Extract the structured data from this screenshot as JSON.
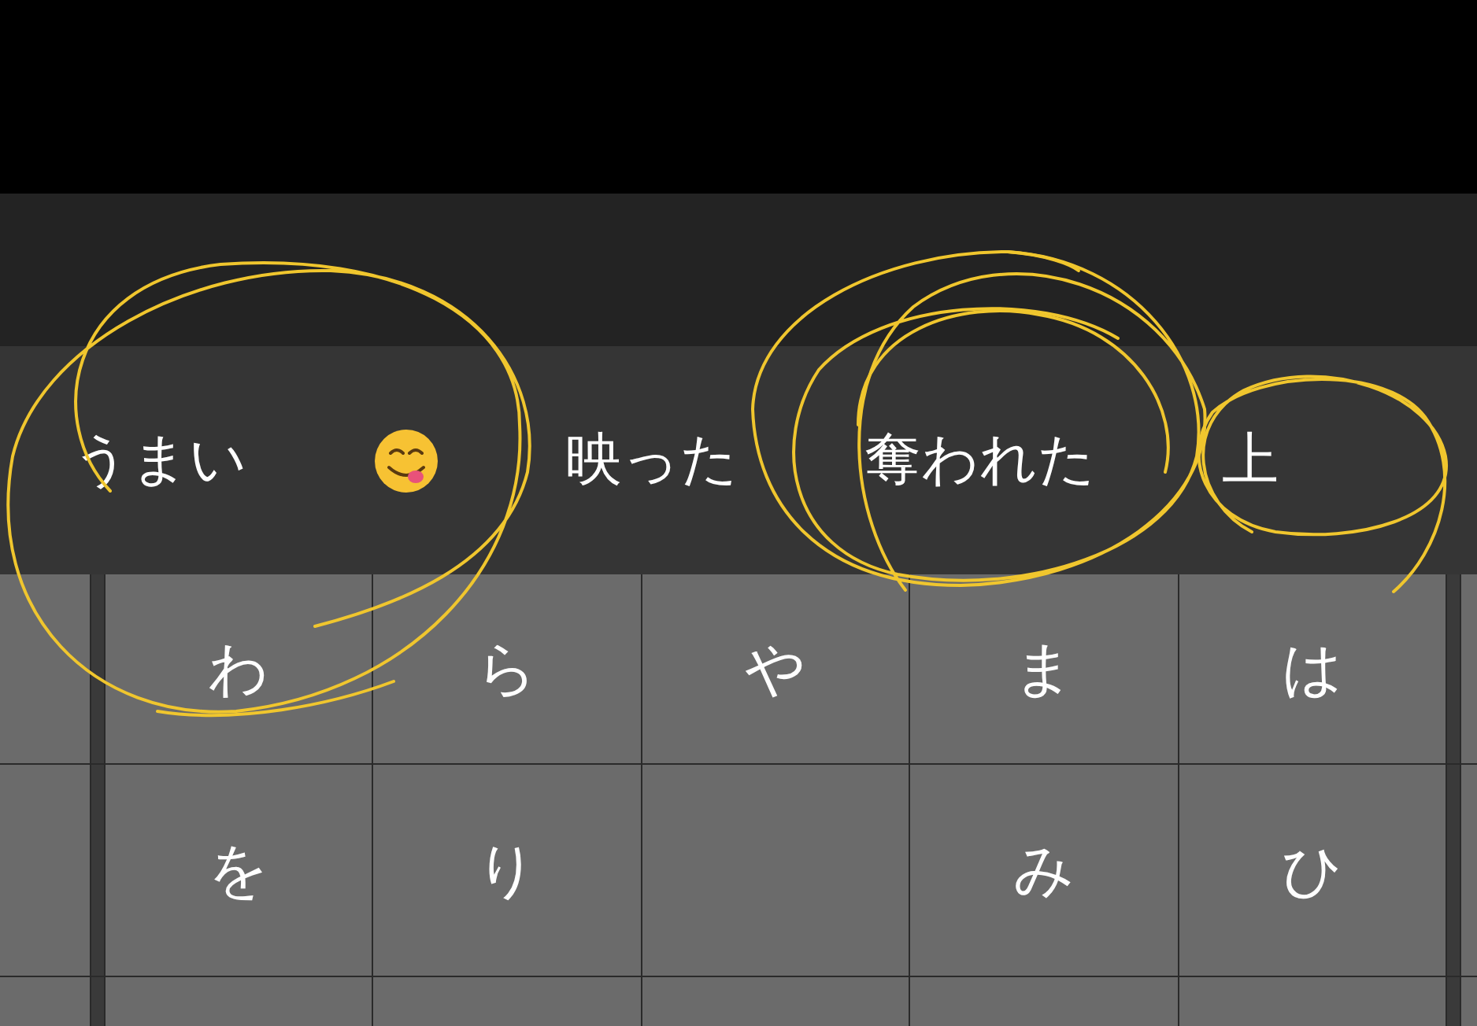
{
  "candidates": [
    {
      "kind": "text",
      "label": "うまい"
    },
    {
      "kind": "emoji"
    },
    {
      "kind": "text",
      "label": "映った"
    },
    {
      "kind": "text",
      "label": "奪われた"
    },
    {
      "kind": "text",
      "label": "上"
    }
  ],
  "keys": [
    [
      {
        "kind": "char",
        "label": "わ"
      },
      {
        "kind": "char",
        "label": "ら"
      },
      {
        "kind": "char",
        "label": "や"
      },
      {
        "kind": "char",
        "label": "ま"
      },
      {
        "kind": "char",
        "label": "は"
      }
    ],
    [
      {
        "kind": "char",
        "label": "を"
      },
      {
        "kind": "char",
        "label": "り"
      },
      {
        "kind": "blank"
      },
      {
        "kind": "char",
        "label": "み"
      },
      {
        "kind": "char",
        "label": "ひ"
      }
    ],
    [
      {
        "kind": "blank"
      },
      {
        "kind": "blank"
      },
      {
        "kind": "blank"
      },
      {
        "kind": "blank"
      },
      {
        "kind": "blank"
      }
    ]
  ]
}
